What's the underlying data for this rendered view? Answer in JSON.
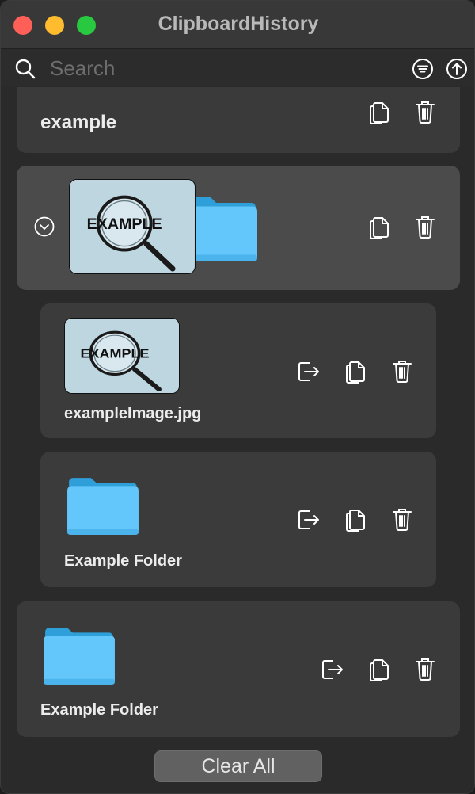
{
  "window": {
    "title": "ClipboardHistory"
  },
  "search": {
    "placeholder": "Search",
    "value": ""
  },
  "items": [
    {
      "type": "text",
      "label": "example"
    },
    {
      "type": "group",
      "expanded": true,
      "children": [
        {
          "type": "image",
          "label": "exampleImage.jpg",
          "thumb_text": "EXAMPLE"
        },
        {
          "type": "folder",
          "label": "Example Folder"
        }
      ]
    },
    {
      "type": "folder",
      "label": "Example Folder"
    }
  ],
  "thumb_text": "EXAMPLE",
  "footer": {
    "clear_label": "Clear All"
  },
  "colors": {
    "folder": "#5ac8fa",
    "folder_dark": "#2f9fd9",
    "close": "#fe5f57",
    "minimize": "#febc2e",
    "maximize": "#28c840"
  }
}
